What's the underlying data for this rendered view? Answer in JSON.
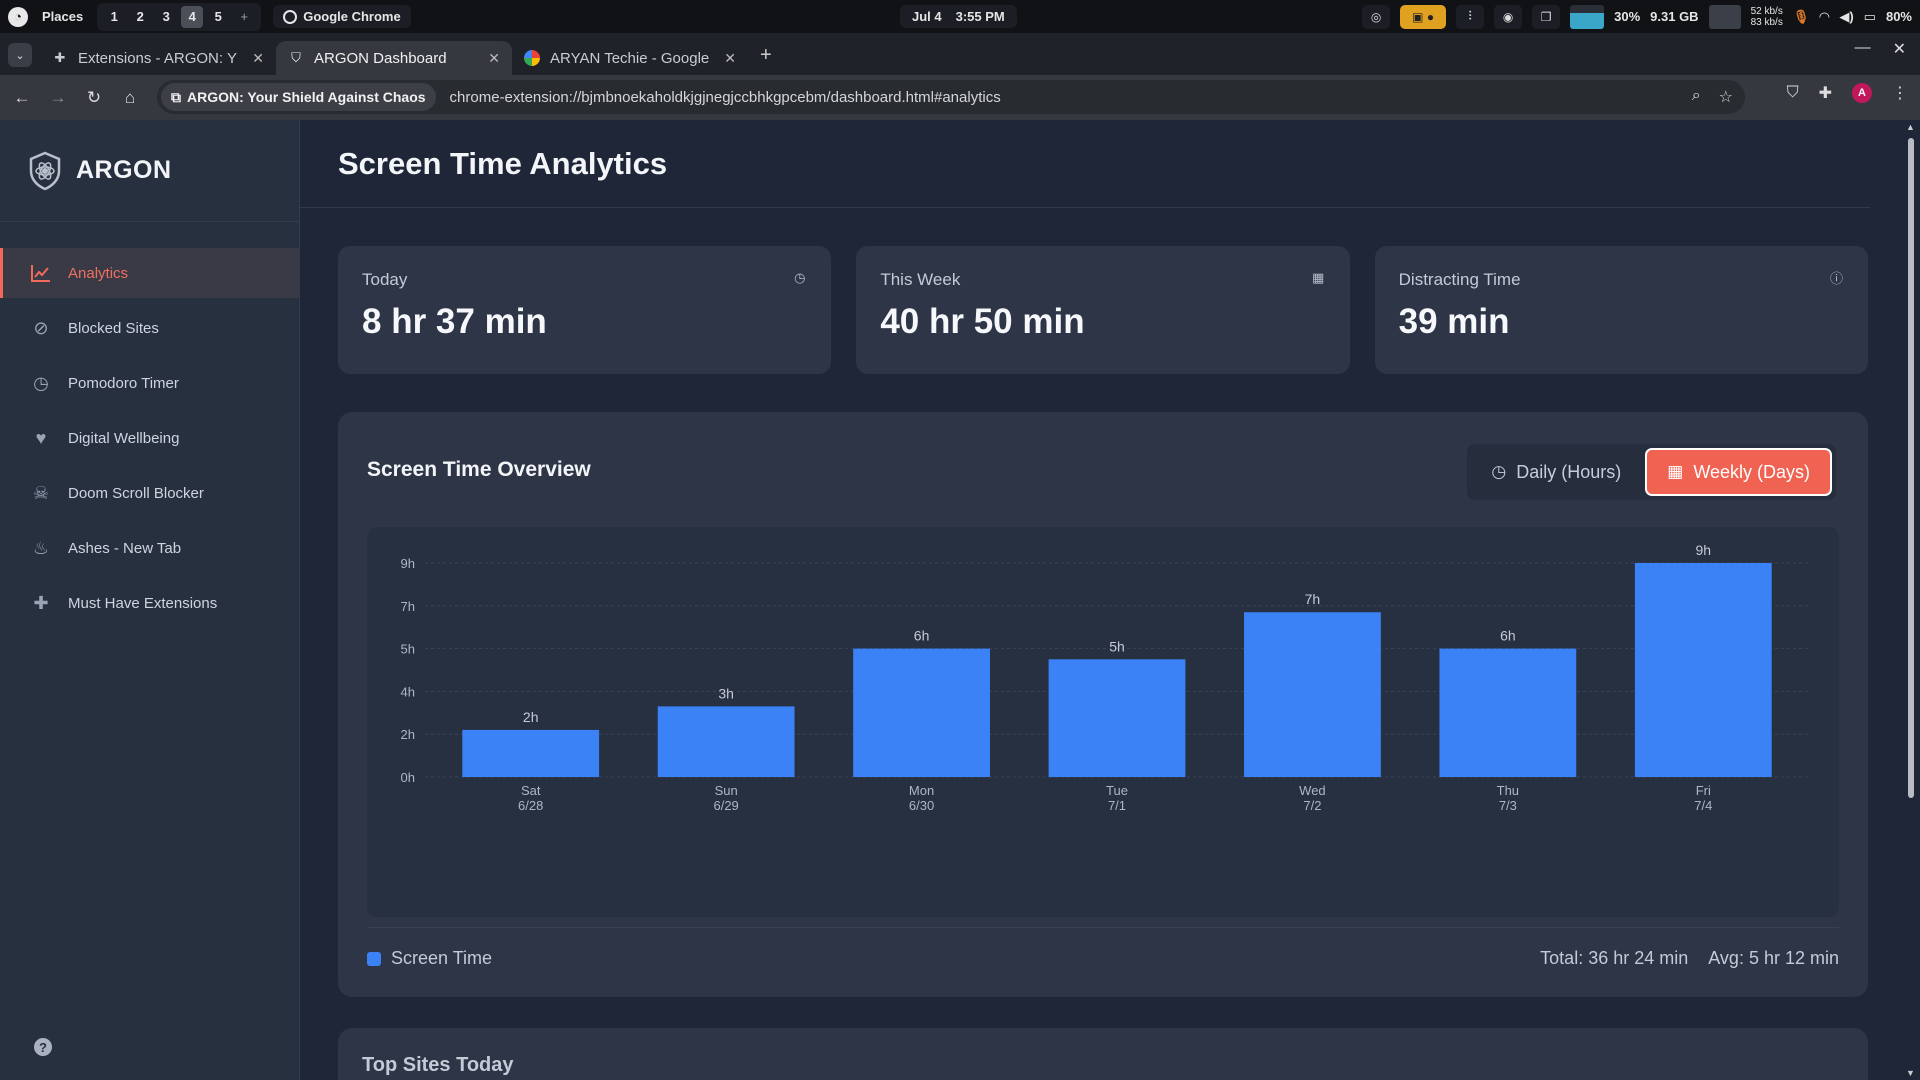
{
  "os": {
    "places_label": "Places",
    "workspaces": [
      "1",
      "2",
      "3",
      "4",
      "5",
      "+"
    ],
    "active_workspace": "4",
    "app_name": "Google Chrome",
    "date": "Jul 4",
    "time": "3:55 PM",
    "cpu": "30%",
    "memory": "9.31 GB",
    "net_up": "52 kb/s",
    "net_down": "83 kb/s",
    "battery": "80%"
  },
  "browser": {
    "tabs": [
      {
        "title": "Extensions - ARGON: Y",
        "icon": "puzzle-icon",
        "active": false
      },
      {
        "title": "ARGON Dashboard",
        "icon": "shield-icon",
        "active": true
      },
      {
        "title": "ARYAN Techie - Google",
        "icon": "google-icon",
        "active": false
      }
    ],
    "site_chip": "ARGON: Your Shield Against Chaos",
    "url": "chrome-extension://bjmbnoekaholdkjgjnegjccbhkgpcebm/dashboard.html#analytics",
    "avatar_letter": "A"
  },
  "sidebar": {
    "brand": "ARGON",
    "items": [
      {
        "label": "Analytics",
        "icon": "analytics-chart-icon",
        "active": true
      },
      {
        "label": "Blocked Sites",
        "icon": "ban-icon",
        "active": false
      },
      {
        "label": "Pomodoro Timer",
        "icon": "clock-icon",
        "active": false
      },
      {
        "label": "Digital Wellbeing",
        "icon": "heart-pulse-icon",
        "active": false
      },
      {
        "label": "Doom Scroll Blocker",
        "icon": "skull-icon",
        "active": false
      },
      {
        "label": "Ashes - New Tab",
        "icon": "fire-icon",
        "active": false
      },
      {
        "label": "Must Have Extensions",
        "icon": "puzzle-icon",
        "active": false
      }
    ],
    "help_glyph": "?"
  },
  "main": {
    "title": "Screen Time Analytics",
    "stats": [
      {
        "label": "Today",
        "value": "8 hr 37 min",
        "icon": "clock-icon"
      },
      {
        "label": "This Week",
        "value": "40 hr 50 min",
        "icon": "calendar-icon"
      },
      {
        "label": "Distracting Time",
        "value": "39 min",
        "icon": "info-icon"
      }
    ],
    "overview": {
      "title": "Screen Time Overview",
      "toggle_daily": "Daily (Hours)",
      "toggle_weekly": "Weekly (Days)",
      "legend_label": "Screen Time",
      "total": "Total: 36 hr 24 min",
      "average": "Avg: 5 hr 12 min"
    },
    "top_sites_title": "Top Sites Today"
  },
  "colors": {
    "accent": "#f06353",
    "bar": "#3b82f6",
    "background": "#1e2637",
    "card": "#2d3546"
  },
  "chart_data": {
    "type": "bar",
    "categories": [
      {
        "day": "Sat",
        "date": "6/28"
      },
      {
        "day": "Sun",
        "date": "6/29"
      },
      {
        "day": "Mon",
        "date": "6/30"
      },
      {
        "day": "Tue",
        "date": "7/1"
      },
      {
        "day": "Wed",
        "date": "7/2"
      },
      {
        "day": "Thu",
        "date": "7/3"
      },
      {
        "day": "Fri",
        "date": "7/4"
      }
    ],
    "values": [
      2.2,
      3.3,
      6.0,
      5.5,
      7.7,
      6.0,
      10.0
    ],
    "data_labels": [
      "2h",
      "3h",
      "6h",
      "5h",
      "7h",
      "6h",
      "9h"
    ],
    "y_ticks": [
      {
        "label": "0h",
        "value": 0
      },
      {
        "label": "2h",
        "value": 2
      },
      {
        "label": "4h",
        "value": 4
      },
      {
        "label": "5h",
        "value": 6
      },
      {
        "label": "7h",
        "value": 8
      },
      {
        "label": "9h",
        "value": 10
      }
    ],
    "ylim": [
      0,
      10
    ],
    "grid": true,
    "legend": "bottom-left",
    "series_name": "Screen Time"
  }
}
